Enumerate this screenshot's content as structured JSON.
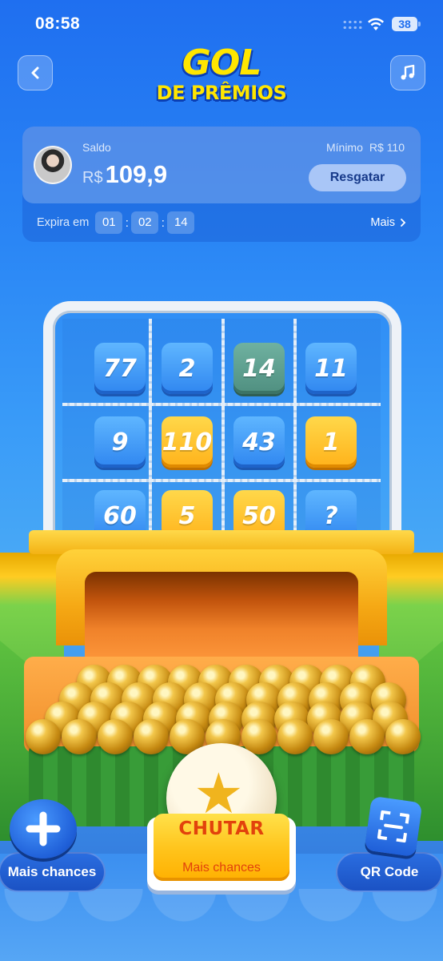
{
  "status_bar": {
    "time": "08:58",
    "battery": "38"
  },
  "header": {
    "logo_line1": "GOL",
    "logo_line2": "DE PRÊMIOS"
  },
  "balance": {
    "label": "Saldo",
    "currency": "R$",
    "amount": "109,9",
    "minimum_label": "Mínimo",
    "minimum_value": "R$ 110",
    "redeem_label": "Resgatar",
    "expires_label": "Expira em",
    "timer": [
      "01",
      "02",
      "14"
    ],
    "more_label": "Mais"
  },
  "grid": {
    "tiles": [
      {
        "value": "77",
        "style": "blue"
      },
      {
        "value": "2",
        "style": "blue"
      },
      {
        "value": "14",
        "style": "green"
      },
      {
        "value": "11",
        "style": "blue"
      },
      {
        "value": "9",
        "style": "blue"
      },
      {
        "value": "110",
        "style": "gold"
      },
      {
        "value": "43",
        "style": "blue"
      },
      {
        "value": "1",
        "style": "gold"
      },
      {
        "value": "60",
        "style": "blue"
      },
      {
        "value": "5",
        "style": "gold"
      },
      {
        "value": "50",
        "style": "gold"
      },
      {
        "value": "?",
        "style": "blue"
      }
    ]
  },
  "actions": {
    "more_chances_label": "Mais chances",
    "kick_label": "CHUTAR",
    "kick_sub_label": "Mais chances",
    "qr_label": "QR Code"
  }
}
